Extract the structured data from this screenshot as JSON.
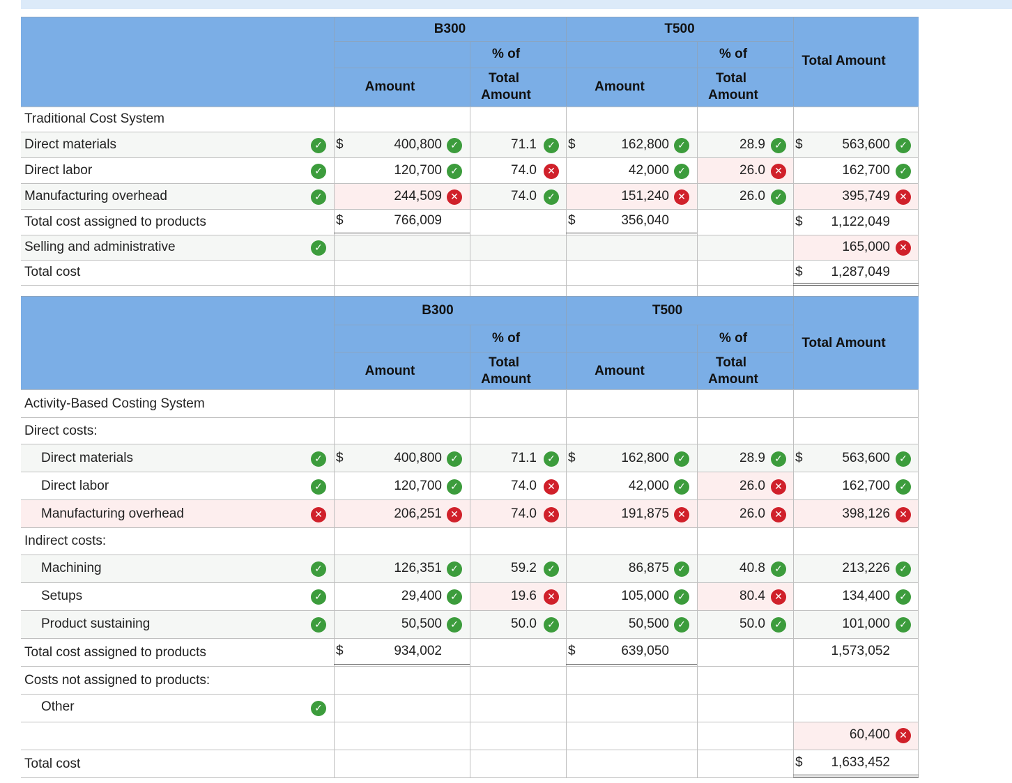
{
  "header": {
    "b300": "B300",
    "t500": "T500",
    "amount": "Amount",
    "pct_line1": "% of",
    "pct_line2": "Total",
    "pct_line3": "Amount",
    "total_amount": "Total Amount"
  },
  "status_colors": {
    "correct": "#3c9c3c",
    "incorrect": "#d0202a",
    "header_bg": "#7baee6"
  },
  "traditional": {
    "title": "Traditional Cost System",
    "rows": [
      {
        "label": "Direct materials",
        "b300_amount": "400,800",
        "b300_pct": "71.1",
        "t500_amount": "162,800",
        "t500_pct": "28.9",
        "total": "563,600"
      },
      {
        "label": "Direct labor",
        "b300_amount": "120,700",
        "b300_pct": "74.0",
        "t500_amount": "42,000",
        "t500_pct": "26.0",
        "total": "162,700"
      },
      {
        "label": "Manufacturing overhead",
        "b300_amount": "244,509",
        "b300_pct": "74.0",
        "t500_amount": "151,240",
        "t500_pct": "26.0",
        "total": "395,749"
      },
      {
        "label": "Total cost assigned to products",
        "b300_amount": "766,009",
        "t500_amount": "356,040",
        "total": "1,122,049"
      },
      {
        "label": "Selling and administrative",
        "total": "165,000"
      },
      {
        "label": "Total cost",
        "total": "1,287,049"
      }
    ]
  },
  "abc": {
    "title": "Activity-Based Costing System",
    "direct_costs": "Direct costs:",
    "indirect_costs": "Indirect costs:",
    "not_assigned": "Costs not assigned to products:",
    "rows": [
      {
        "label": "Direct materials",
        "b300_amount": "400,800",
        "b300_pct": "71.1",
        "t500_amount": "162,800",
        "t500_pct": "28.9",
        "total": "563,600"
      },
      {
        "label": "Direct labor",
        "b300_amount": "120,700",
        "b300_pct": "74.0",
        "t500_amount": "42,000",
        "t500_pct": "26.0",
        "total": "162,700"
      },
      {
        "label": "Manufacturing overhead",
        "b300_amount": "206,251",
        "b300_pct": "74.0",
        "t500_amount": "191,875",
        "t500_pct": "26.0",
        "total": "398,126"
      },
      {
        "label": "Machining",
        "b300_amount": "126,351",
        "b300_pct": "59.2",
        "t500_amount": "86,875",
        "t500_pct": "40.8",
        "total": "213,226"
      },
      {
        "label": "Setups",
        "b300_amount": "29,400",
        "b300_pct": "19.6",
        "t500_amount": "105,000",
        "t500_pct": "80.4",
        "total": "134,400"
      },
      {
        "label": "Product sustaining",
        "b300_amount": "50,500",
        "b300_pct": "50.0",
        "t500_amount": "50,500",
        "t500_pct": "50.0",
        "total": "101,000"
      },
      {
        "label": "Total cost assigned to products",
        "b300_amount": "934,002",
        "t500_amount": "639,050",
        "total": "1,573,052"
      },
      {
        "label": "Other",
        "total": "60,400"
      },
      {
        "label": "Total cost",
        "total": "1,633,452"
      }
    ]
  },
  "currency": "$"
}
